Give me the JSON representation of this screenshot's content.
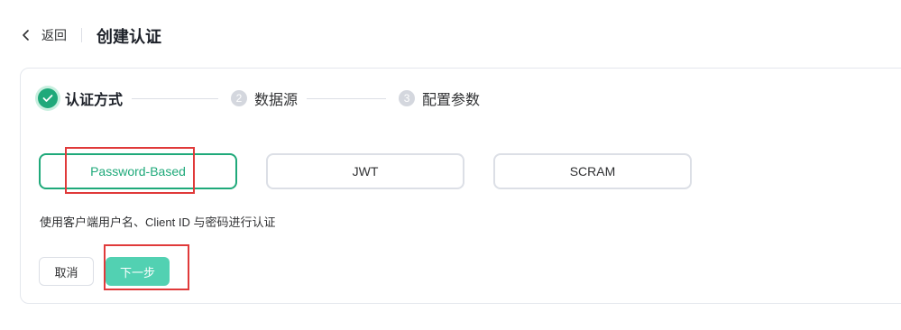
{
  "header": {
    "back_label": "返回",
    "title": "创建认证"
  },
  "steps": [
    {
      "index": "1",
      "label": "认证方式",
      "status": "done"
    },
    {
      "index": "2",
      "label": "数据源",
      "status": "pending"
    },
    {
      "index": "3",
      "label": "配置参数",
      "status": "pending"
    }
  ],
  "options": [
    {
      "label": "Password-Based",
      "selected": true
    },
    {
      "label": "JWT",
      "selected": false
    },
    {
      "label": "SCRAM",
      "selected": false
    }
  ],
  "description": "使用客户端用户名、Client ID 与密码进行认证",
  "buttons": {
    "cancel_label": "取消",
    "next_label": "下一步"
  },
  "colors": {
    "accent": "#1fa97a",
    "next_button": "#52d1b2",
    "highlight": "#e03a3a"
  },
  "icons": {
    "back": "chevron-left-icon",
    "step_done": "check-icon"
  }
}
